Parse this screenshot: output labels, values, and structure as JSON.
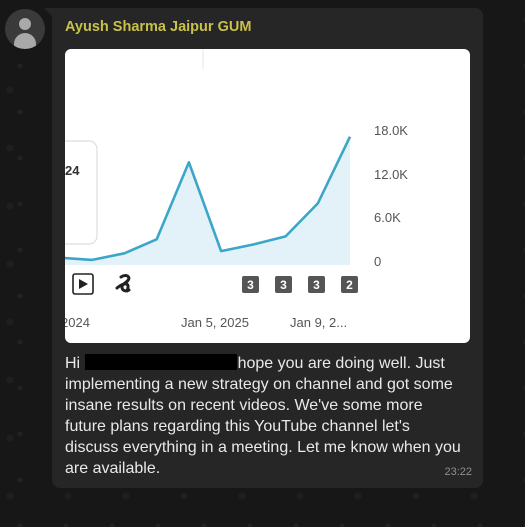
{
  "chat": {
    "sender": "Ayush Sharma Jaipur GUM",
    "message_greeting": "Hi",
    "message_body": "hope you are doing well. Just implementing a new strategy on channel and got some insane results on recent videos. We've some more future plans regarding this YouTube channel let's discuss everything in a meeting. Let me know when you are available.",
    "time": "23:22"
  },
  "chart_data": {
    "type": "area",
    "x_tick_labels": [
      "2024",
      "Jan 5, 2025",
      "Jan 9, 2..."
    ],
    "y_tick_labels": [
      "18.0K",
      "12.0K",
      "6.0K",
      "0"
    ],
    "ylim": [
      0,
      18000
    ],
    "values": [
      1000,
      700,
      1600,
      3500,
      14000,
      1900,
      2800,
      3900,
      8400,
      17500
    ],
    "tooltip_partial_text": "24",
    "video_markers": [
      {
        "icon": "play-icon"
      },
      {
        "icon": "shorts-icon"
      },
      {
        "label": "3"
      },
      {
        "label": "3"
      },
      {
        "label": "3"
      },
      {
        "label": "2"
      }
    ],
    "colors": {
      "line": "#3ba6c8",
      "fill": "#e3f1f8"
    }
  }
}
